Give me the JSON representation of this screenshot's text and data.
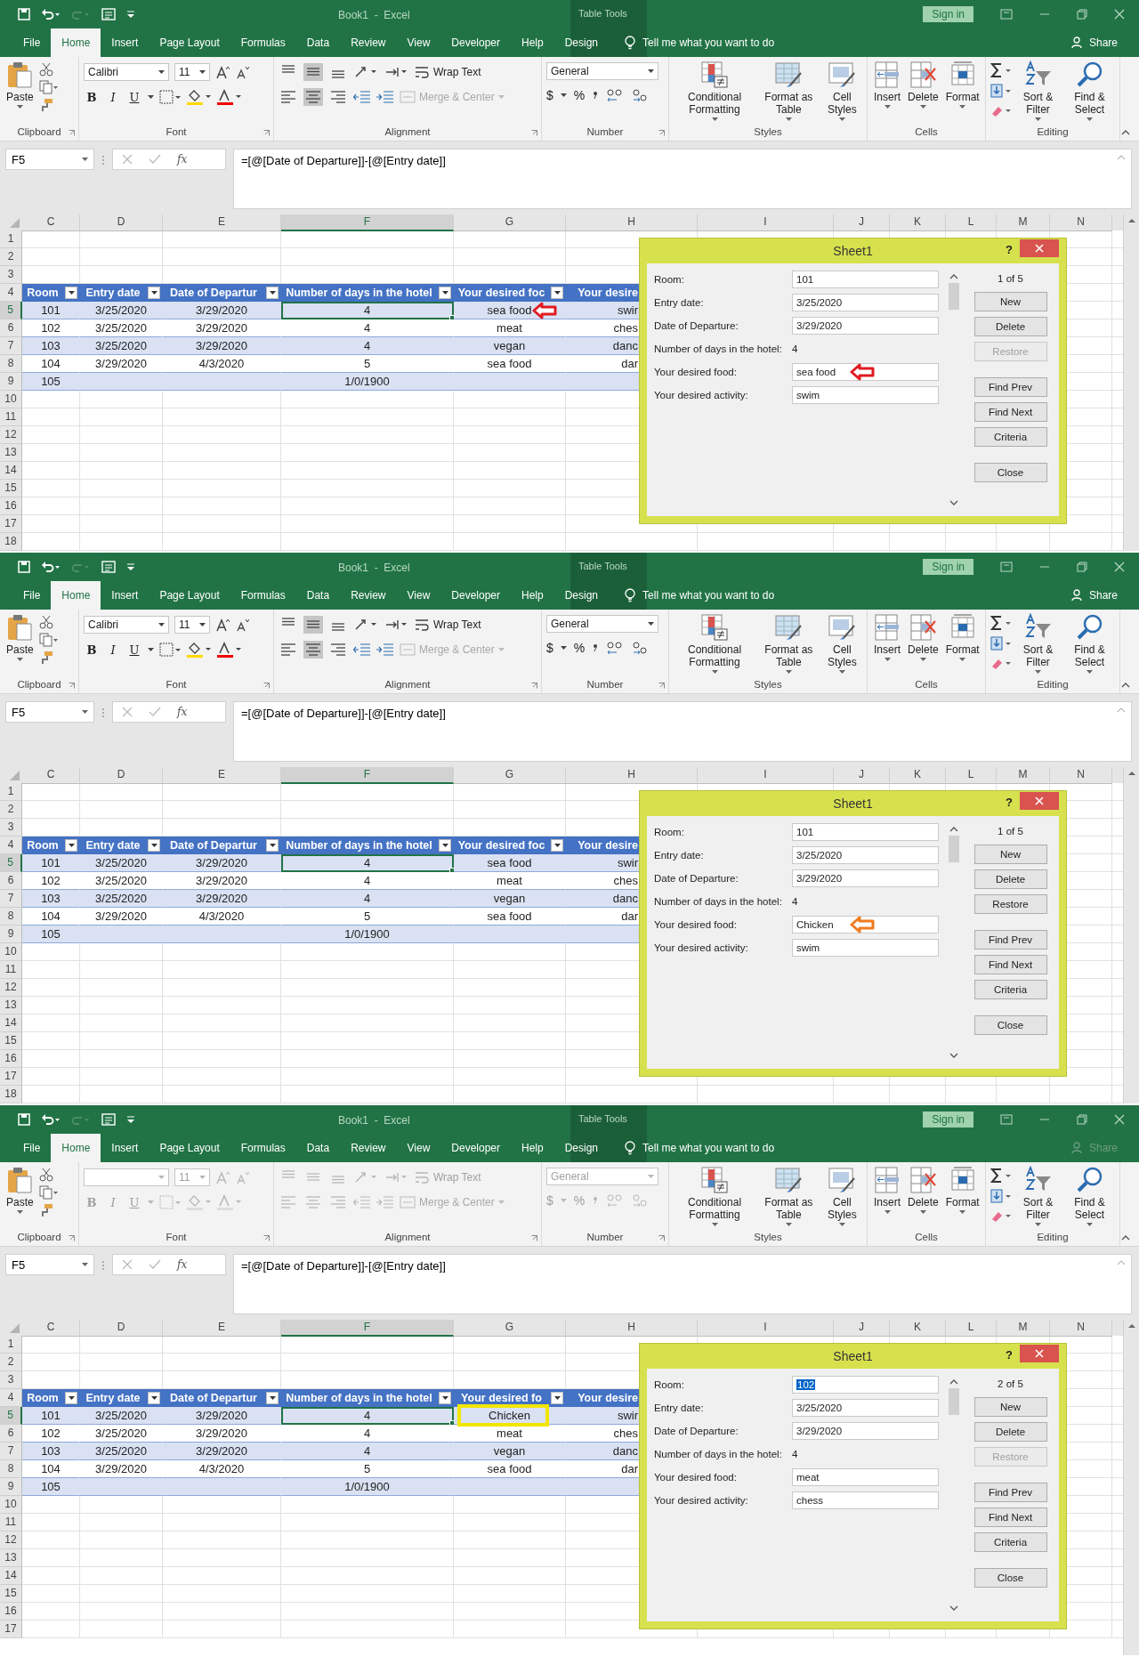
{
  "panels": [
    {
      "title": "Book1  -  Excel",
      "context_label": "Table Tools",
      "sign_in": "Sign in",
      "tabs": [
        {
          "label": "File",
          "selected": false
        },
        {
          "label": "Home",
          "selected": true
        },
        {
          "label": "Insert",
          "selected": false
        },
        {
          "label": "Page Layout",
          "selected": false
        },
        {
          "label": "Formulas",
          "selected": false
        },
        {
          "label": "Data",
          "selected": false
        },
        {
          "label": "Review",
          "selected": false
        },
        {
          "label": "View",
          "selected": false
        },
        {
          "label": "Developer",
          "selected": false
        },
        {
          "label": "Help",
          "selected": false
        },
        {
          "label": "Design",
          "selected": false
        }
      ],
      "tell_me": "Tell me what you want to do",
      "share": {
        "label": "Share",
        "disabled": false
      },
      "ribbon": {
        "format_disabled": false,
        "paste": "Paste",
        "font_name": "Calibri",
        "font_size": "11",
        "font_buttons": [
          "B",
          "I",
          "U"
        ],
        "wrap_text": "Wrap Text",
        "merge_center": "Merge & Center",
        "number_format": "General",
        "number_buttons": [
          "$",
          "%"
        ],
        "styles": [
          "Conditional Formatting",
          "Format as Table",
          "Cell Styles"
        ],
        "cells": [
          "Insert",
          "Delete",
          "Format"
        ],
        "editing": [
          "Sort & Filter",
          "Find & Select"
        ],
        "groups": [
          "Clipboard",
          "Font",
          "Alignment",
          "Number",
          "Styles",
          "Cells",
          "Editing"
        ]
      },
      "name_box": "F5",
      "fx": "fx",
      "formula": "=[@[Date of Departure]]-[@[Entry date]]",
      "columns": [
        {
          "label": "C",
          "selected": false
        },
        {
          "label": "D",
          "selected": false
        },
        {
          "label": "E",
          "selected": false
        },
        {
          "label": "F",
          "selected": true
        },
        {
          "label": "G",
          "selected": false
        },
        {
          "label": "H",
          "selected": false
        },
        {
          "label": "I",
          "selected": false
        },
        {
          "label": "J",
          "selected": false
        },
        {
          "label": "K",
          "selected": false
        },
        {
          "label": "L",
          "selected": false
        },
        {
          "label": "M",
          "selected": false
        },
        {
          "label": "N",
          "selected": false
        }
      ],
      "rows": [
        {
          "label": "1",
          "selected": false,
          "kind": "empty"
        },
        {
          "label": "2",
          "selected": false,
          "kind": "empty"
        },
        {
          "label": "3",
          "selected": false,
          "kind": "empty"
        },
        {
          "label": "4",
          "selected": false,
          "kind": "header",
          "cells": [
            "Room",
            "Entry date",
            "Date of Departur",
            "Number of days in the hotel",
            "Your desired foc",
            "Your desire"
          ]
        },
        {
          "label": "5",
          "selected": true,
          "kind": "band",
          "cells": [
            "101",
            "3/25/2020",
            "3/29/2020",
            "4",
            {
              "text": "sea food",
              "marker": {
                "kind": "arrow",
                "color": "#e01b22"
              }
            },
            "swir"
          ]
        },
        {
          "label": "6",
          "selected": false,
          "kind": "plain",
          "cells": [
            "102",
            "3/25/2020",
            "3/29/2020",
            "4",
            "meat",
            "ches"
          ]
        },
        {
          "label": "7",
          "selected": false,
          "kind": "band",
          "cells": [
            "103",
            "3/25/2020",
            "3/29/2020",
            "4",
            "vegan",
            "danc"
          ]
        },
        {
          "label": "8",
          "selected": false,
          "kind": "plain",
          "cells": [
            "104",
            "3/29/2020",
            "4/3/2020",
            "5",
            "sea food",
            "dar"
          ]
        },
        {
          "label": "9",
          "selected": false,
          "kind": "band",
          "cells": [
            "105",
            null,
            null,
            "1/0/1900",
            null,
            null
          ]
        },
        {
          "label": "10",
          "selected": false,
          "kind": "empty"
        },
        {
          "label": "11",
          "selected": false,
          "kind": "empty"
        },
        {
          "label": "12",
          "selected": false,
          "kind": "empty"
        },
        {
          "label": "13",
          "selected": false,
          "kind": "empty"
        },
        {
          "label": "14",
          "selected": false,
          "kind": "empty"
        },
        {
          "label": "15",
          "selected": false,
          "kind": "empty"
        },
        {
          "label": "16",
          "selected": false,
          "kind": "empty"
        },
        {
          "label": "17",
          "selected": false,
          "kind": "empty"
        },
        {
          "label": "18",
          "selected": false,
          "kind": "empty"
        }
      ],
      "dialog": {
        "title": "Sheet1",
        "help": "?",
        "record": "1 of 5",
        "fields": [
          {
            "label": "Room:",
            "value": "101",
            "kind": "input",
            "highlighted": false
          },
          {
            "label": "Entry date:",
            "value": "3/25/2020",
            "kind": "input",
            "highlighted": false
          },
          {
            "label": "Date of Departure:",
            "value": "3/29/2020",
            "kind": "input",
            "highlighted": false
          },
          {
            "label": "Number of days in the hotel:",
            "value": "4",
            "kind": "readonly",
            "highlighted": false
          },
          {
            "label": "Your desired food:",
            "value": "sea food",
            "kind": "input",
            "highlighted": false,
            "marker": {
              "kind": "arrow",
              "color": "#e01b22"
            }
          },
          {
            "label": "Your desired activity:",
            "value": "swim",
            "kind": "input",
            "highlighted": false
          }
        ],
        "buttons": [
          {
            "label": "New",
            "disabled": false
          },
          {
            "label": "Delete",
            "disabled": false
          },
          {
            "label": "Restore",
            "disabled": true
          },
          {
            "label": "Find Prev",
            "disabled": false
          },
          {
            "label": "Find Next",
            "disabled": false
          },
          {
            "label": "Criteria",
            "disabled": false
          },
          {
            "label": "Close",
            "disabled": false
          }
        ]
      }
    },
    {
      "title": "Book1  -  Excel",
      "context_label": "Table Tools",
      "sign_in": "Sign in",
      "tabs": [
        {
          "label": "File",
          "selected": false
        },
        {
          "label": "Home",
          "selected": true
        },
        {
          "label": "Insert",
          "selected": false
        },
        {
          "label": "Page Layout",
          "selected": false
        },
        {
          "label": "Formulas",
          "selected": false
        },
        {
          "label": "Data",
          "selected": false
        },
        {
          "label": "Review",
          "selected": false
        },
        {
          "label": "View",
          "selected": false
        },
        {
          "label": "Developer",
          "selected": false
        },
        {
          "label": "Help",
          "selected": false
        },
        {
          "label": "Design",
          "selected": false
        }
      ],
      "tell_me": "Tell me what you want to do",
      "share": {
        "label": "Share",
        "disabled": false
      },
      "ribbon": {
        "format_disabled": false,
        "paste": "Paste",
        "font_name": "Calibri",
        "font_size": "11",
        "font_buttons": [
          "B",
          "I",
          "U"
        ],
        "wrap_text": "Wrap Text",
        "merge_center": "Merge & Center",
        "number_format": "General",
        "number_buttons": [
          "$",
          "%"
        ],
        "styles": [
          "Conditional Formatting",
          "Format as Table",
          "Cell Styles"
        ],
        "cells": [
          "Insert",
          "Delete",
          "Format"
        ],
        "editing": [
          "Sort & Filter",
          "Find & Select"
        ],
        "groups": [
          "Clipboard",
          "Font",
          "Alignment",
          "Number",
          "Styles",
          "Cells",
          "Editing"
        ]
      },
      "name_box": "F5",
      "fx": "fx",
      "formula": "=[@[Date of Departure]]-[@[Entry date]]",
      "columns": [
        {
          "label": "C",
          "selected": false
        },
        {
          "label": "D",
          "selected": false
        },
        {
          "label": "E",
          "selected": false
        },
        {
          "label": "F",
          "selected": true
        },
        {
          "label": "G",
          "selected": false
        },
        {
          "label": "H",
          "selected": false
        },
        {
          "label": "I",
          "selected": false
        },
        {
          "label": "J",
          "selected": false
        },
        {
          "label": "K",
          "selected": false
        },
        {
          "label": "L",
          "selected": false
        },
        {
          "label": "M",
          "selected": false
        },
        {
          "label": "N",
          "selected": false
        }
      ],
      "rows": [
        {
          "label": "1",
          "selected": false,
          "kind": "empty"
        },
        {
          "label": "2",
          "selected": false,
          "kind": "empty"
        },
        {
          "label": "3",
          "selected": false,
          "kind": "empty"
        },
        {
          "label": "4",
          "selected": false,
          "kind": "header",
          "cells": [
            "Room",
            "Entry date",
            "Date of Departur",
            "Number of days in the hotel",
            "Your desired foc",
            "Your desire"
          ]
        },
        {
          "label": "5",
          "selected": true,
          "kind": "band",
          "cells": [
            "101",
            "3/25/2020",
            "3/29/2020",
            "4",
            "sea food",
            "swir"
          ]
        },
        {
          "label": "6",
          "selected": false,
          "kind": "plain",
          "cells": [
            "102",
            "3/25/2020",
            "3/29/2020",
            "4",
            "meat",
            "ches"
          ]
        },
        {
          "label": "7",
          "selected": false,
          "kind": "band",
          "cells": [
            "103",
            "3/25/2020",
            "3/29/2020",
            "4",
            "vegan",
            "danc"
          ]
        },
        {
          "label": "8",
          "selected": false,
          "kind": "plain",
          "cells": [
            "104",
            "3/29/2020",
            "4/3/2020",
            "5",
            "sea food",
            "dar"
          ]
        },
        {
          "label": "9",
          "selected": false,
          "kind": "band",
          "cells": [
            "105",
            null,
            null,
            "1/0/1900",
            null,
            null
          ]
        },
        {
          "label": "10",
          "selected": false,
          "kind": "empty"
        },
        {
          "label": "11",
          "selected": false,
          "kind": "empty"
        },
        {
          "label": "12",
          "selected": false,
          "kind": "empty"
        },
        {
          "label": "13",
          "selected": false,
          "kind": "empty"
        },
        {
          "label": "14",
          "selected": false,
          "kind": "empty"
        },
        {
          "label": "15",
          "selected": false,
          "kind": "empty"
        },
        {
          "label": "16",
          "selected": false,
          "kind": "empty"
        },
        {
          "label": "17",
          "selected": false,
          "kind": "empty"
        },
        {
          "label": "18",
          "selected": false,
          "kind": "empty"
        }
      ],
      "dialog": {
        "title": "Sheet1",
        "help": "?",
        "record": "1 of 5",
        "fields": [
          {
            "label": "Room:",
            "value": "101",
            "kind": "input",
            "highlighted": false
          },
          {
            "label": "Entry date:",
            "value": "3/25/2020",
            "kind": "input",
            "highlighted": false
          },
          {
            "label": "Date of Departure:",
            "value": "3/29/2020",
            "kind": "input",
            "highlighted": false
          },
          {
            "label": "Number of days in the hotel:",
            "value": "4",
            "kind": "readonly",
            "highlighted": false
          },
          {
            "label": "Your desired food:",
            "value": "Chicken",
            "kind": "input",
            "highlighted": false,
            "marker": {
              "kind": "arrow",
              "color": "#f07c1e"
            }
          },
          {
            "label": "Your desired activity:",
            "value": "swim",
            "kind": "input",
            "highlighted": false
          }
        ],
        "buttons": [
          {
            "label": "New",
            "disabled": false
          },
          {
            "label": "Delete",
            "disabled": false
          },
          {
            "label": "Restore",
            "disabled": false
          },
          {
            "label": "Find Prev",
            "disabled": false
          },
          {
            "label": "Find Next",
            "disabled": false
          },
          {
            "label": "Criteria",
            "disabled": false
          },
          {
            "label": "Close",
            "disabled": false
          }
        ]
      }
    },
    {
      "title": "Book1  -  Excel",
      "context_label": "Table Tools",
      "sign_in": "Sign in",
      "tabs": [
        {
          "label": "File",
          "selected": false
        },
        {
          "label": "Home",
          "selected": true
        },
        {
          "label": "Insert",
          "selected": false
        },
        {
          "label": "Page Layout",
          "selected": false
        },
        {
          "label": "Formulas",
          "selected": false
        },
        {
          "label": "Data",
          "selected": false
        },
        {
          "label": "Review",
          "selected": false
        },
        {
          "label": "View",
          "selected": false
        },
        {
          "label": "Developer",
          "selected": false
        },
        {
          "label": "Help",
          "selected": false
        },
        {
          "label": "Design",
          "selected": false
        }
      ],
      "tell_me": "Tell me what you want to do",
      "share": {
        "label": "Share",
        "disabled": true
      },
      "ribbon": {
        "format_disabled": true,
        "paste": "Paste",
        "font_size": "11",
        "font_buttons": [
          "B",
          "I",
          "U"
        ],
        "wrap_text": "Wrap Text",
        "merge_center": "Merge & Center",
        "number_format": "General",
        "number_buttons": [
          "$",
          "%"
        ],
        "styles": [
          "Conditional Formatting",
          "Format as Table",
          "Cell Styles"
        ],
        "cells": [
          "Insert",
          "Delete",
          "Format"
        ],
        "editing": [
          "Sort & Filter",
          "Find & Select"
        ],
        "groups": [
          "Clipboard",
          "Font",
          "Alignment",
          "Number",
          "Styles",
          "Cells",
          "Editing"
        ]
      },
      "name_box": "F5",
      "fx": "fx",
      "formula": "=[@[Date of Departure]]-[@[Entry date]]",
      "columns": [
        {
          "label": "C",
          "selected": false
        },
        {
          "label": "D",
          "selected": false
        },
        {
          "label": "E",
          "selected": false
        },
        {
          "label": "F",
          "selected": true
        },
        {
          "label": "G",
          "selected": false
        },
        {
          "label": "H",
          "selected": false
        },
        {
          "label": "I",
          "selected": false
        },
        {
          "label": "J",
          "selected": false
        },
        {
          "label": "K",
          "selected": false
        },
        {
          "label": "L",
          "selected": false
        },
        {
          "label": "M",
          "selected": false
        },
        {
          "label": "N",
          "selected": false
        }
      ],
      "rows": [
        {
          "label": "1",
          "selected": false,
          "kind": "empty"
        },
        {
          "label": "2",
          "selected": false,
          "kind": "empty"
        },
        {
          "label": "3",
          "selected": false,
          "kind": "empty"
        },
        {
          "label": "4",
          "selected": false,
          "kind": "header",
          "cells": [
            "Room",
            "Entry date",
            "Date of Departur",
            "Number of days in the hotel",
            "Your desired fo",
            "Your desire"
          ]
        },
        {
          "label": "5",
          "selected": true,
          "kind": "band",
          "cells": [
            "101",
            "3/25/2020",
            "3/29/2020",
            "4",
            {
              "text": "Chicken",
              "marker": {
                "kind": "box",
                "color": "#f2e600"
              }
            },
            "swir"
          ]
        },
        {
          "label": "6",
          "selected": false,
          "kind": "plain",
          "cells": [
            "102",
            "3/25/2020",
            "3/29/2020",
            "4",
            "meat",
            "ches"
          ]
        },
        {
          "label": "7",
          "selected": false,
          "kind": "band",
          "cells": [
            "103",
            "3/25/2020",
            "3/29/2020",
            "4",
            "vegan",
            "danc"
          ]
        },
        {
          "label": "8",
          "selected": false,
          "kind": "plain",
          "cells": [
            "104",
            "3/29/2020",
            "4/3/2020",
            "5",
            "sea food",
            "dar"
          ]
        },
        {
          "label": "9",
          "selected": false,
          "kind": "band",
          "cells": [
            "105",
            null,
            null,
            "1/0/1900",
            null,
            null
          ]
        },
        {
          "label": "10",
          "selected": false,
          "kind": "empty"
        },
        {
          "label": "11",
          "selected": false,
          "kind": "empty"
        },
        {
          "label": "12",
          "selected": false,
          "kind": "empty"
        },
        {
          "label": "13",
          "selected": false,
          "kind": "empty"
        },
        {
          "label": "14",
          "selected": false,
          "kind": "empty"
        },
        {
          "label": "15",
          "selected": false,
          "kind": "empty"
        },
        {
          "label": "16",
          "selected": false,
          "kind": "empty"
        },
        {
          "label": "17",
          "selected": false,
          "kind": "empty"
        }
      ],
      "dialog": {
        "title": "Sheet1",
        "help": "?",
        "record": "2 of 5",
        "fields": [
          {
            "label": "Room:",
            "value": "102",
            "kind": "input",
            "highlighted": true
          },
          {
            "label": "Entry date:",
            "value": "3/25/2020",
            "kind": "input",
            "highlighted": false
          },
          {
            "label": "Date of Departure:",
            "value": "3/29/2020",
            "kind": "input",
            "highlighted": false
          },
          {
            "label": "Number of days in the hotel:",
            "value": "4",
            "kind": "readonly",
            "highlighted": false
          },
          {
            "label": "Your desired food:",
            "value": "meat",
            "kind": "input",
            "highlighted": false
          },
          {
            "label": "Your desired activity:",
            "value": "chess",
            "kind": "input",
            "highlighted": false
          }
        ],
        "buttons": [
          {
            "label": "New",
            "disabled": false
          },
          {
            "label": "Delete",
            "disabled": false
          },
          {
            "label": "Restore",
            "disabled": true
          },
          {
            "label": "Find Prev",
            "disabled": false
          },
          {
            "label": "Find Next",
            "disabled": false
          },
          {
            "label": "Criteria",
            "disabled": false
          },
          {
            "label": "Close",
            "disabled": false
          }
        ]
      }
    }
  ]
}
